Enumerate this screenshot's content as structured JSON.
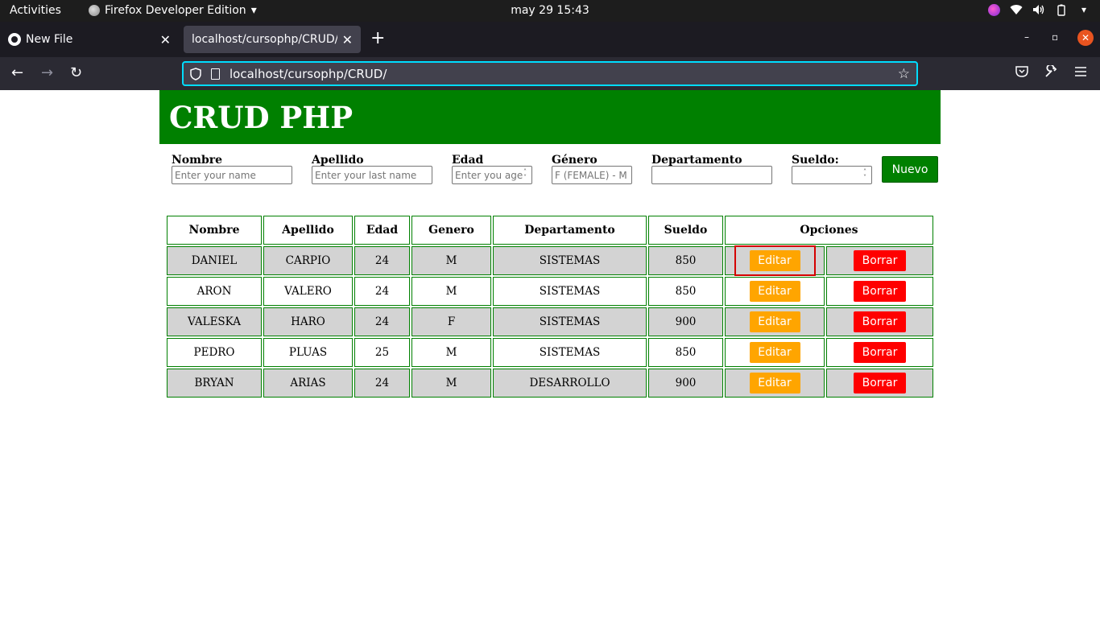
{
  "system_bar": {
    "activities": "Activities",
    "app_name": "Firefox Developer Edition",
    "clock": "may 29  15:43"
  },
  "browser": {
    "tabs": [
      {
        "label": "New File",
        "icon": "github-icon"
      },
      {
        "label": "localhost/cursophp/CRUD/",
        "icon": "none"
      }
    ],
    "url": "localhost/cursophp/CRUD/",
    "active_tab_index": 1
  },
  "page": {
    "title": "CRUD PHP",
    "form": {
      "nombre": {
        "label": "Nombre",
        "placeholder": "Enter your name",
        "value": ""
      },
      "apellido": {
        "label": "Apellido",
        "placeholder": "Enter your last name",
        "value": ""
      },
      "edad": {
        "label": "Edad",
        "placeholder": "Enter you age",
        "value": ""
      },
      "genero": {
        "label": "Género",
        "placeholder": "F (FEMALE) - M (M",
        "value": ""
      },
      "departamento": {
        "label": "Departamento",
        "placeholder": "",
        "value": ""
      },
      "sueldo": {
        "label": "Sueldo:",
        "placeholder": "",
        "value": ""
      },
      "submit_label": "Nuevo"
    },
    "table": {
      "headers": [
        "Nombre",
        "Apellido",
        "Edad",
        "Genero",
        "Departamento",
        "Sueldo",
        "Opciones"
      ],
      "edit_label": "Editar",
      "delete_label": "Borrar",
      "rows": [
        {
          "nombre": "DANIEL",
          "apellido": "CARPIO",
          "edad": "24",
          "genero": "M",
          "departamento": "SISTEMAS",
          "sueldo": "850"
        },
        {
          "nombre": "ARON",
          "apellido": "VALERO",
          "edad": "24",
          "genero": "M",
          "departamento": "SISTEMAS",
          "sueldo": "850"
        },
        {
          "nombre": "VALESKA",
          "apellido": "HARO",
          "edad": "24",
          "genero": "F",
          "departamento": "SISTEMAS",
          "sueldo": "900"
        },
        {
          "nombre": "PEDRO",
          "apellido": "PLUAS",
          "edad": "25",
          "genero": "M",
          "departamento": "SISTEMAS",
          "sueldo": "850"
        },
        {
          "nombre": "BRYAN",
          "apellido": "ARIAS",
          "edad": "24",
          "genero": "M",
          "departamento": "DESARROLLO",
          "sueldo": "900"
        }
      ]
    }
  },
  "colors": {
    "header_green": "#008000",
    "edit_orange": "#ffa500",
    "delete_red": "#ff0000",
    "row_gray": "#d3d3d3"
  }
}
